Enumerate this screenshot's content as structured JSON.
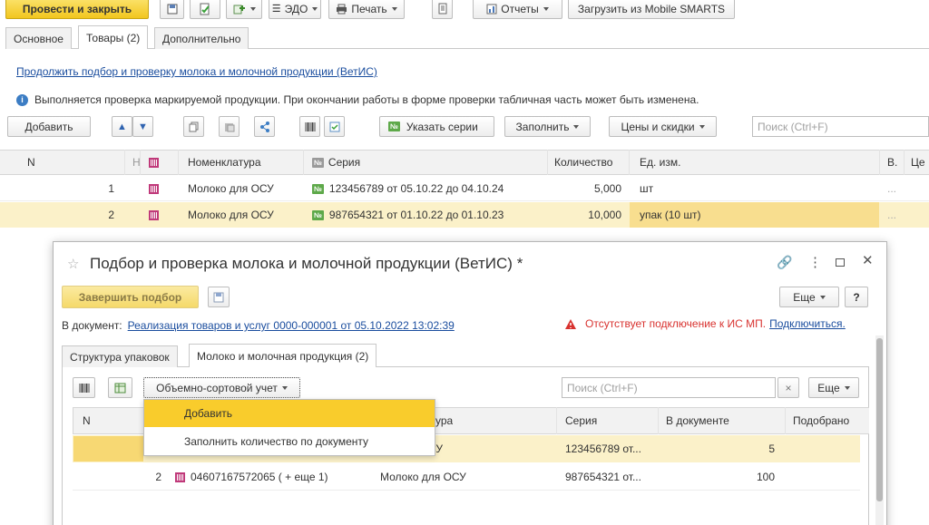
{
  "toolbar": {
    "post_close": "Провести и закрыть",
    "edo": "ЭДО",
    "print": "Печать",
    "reports": "Отчеты",
    "load_mobile": "Загрузить из Mobile SMARTS"
  },
  "tabs": [
    {
      "label": "Основное"
    },
    {
      "label": "Товары (2)"
    },
    {
      "label": "Дополнительно"
    }
  ],
  "continue_link": "Продолжить подбор и проверку молока и молочной продукции (ВетИС)",
  "info_text": "Выполняется проверка маркируемой продукции. При окончании работы в форме проверки табличная часть может быть изменена.",
  "goods_toolbar": {
    "add": "Добавить",
    "series": "Указать серии",
    "fill": "Заполнить",
    "prices": "Цены и скидки",
    "search_placeholder": "Поиск (Ctrl+F)"
  },
  "goods_table": {
    "headers": {
      "n": "N",
      "h": "Н",
      "nom": "Номенклатура",
      "series_no": "№",
      "series": "Серия",
      "qty": "Количество",
      "unit": "Ед. изм.",
      "v": "В.",
      "price": "Це"
    },
    "rows": [
      {
        "n": "1",
        "name": "Молоко для ОСУ",
        "series": "123456789 от 05.10.22 до 04.10.24",
        "qty": "5,000",
        "unit": "шт",
        "v": "..."
      },
      {
        "n": "2",
        "name": "Молоко для ОСУ",
        "series": "987654321 от 01.10.22 до 01.10.23",
        "qty": "10,000",
        "unit": "упак (10 шт)",
        "v": "..."
      }
    ]
  },
  "modal": {
    "title": "Подбор и проверка молока и молочной продукции (ВетИС) *",
    "finish": "Завершить подбор",
    "more": "Еще",
    "help": "?",
    "doc_label": "В документ:",
    "doc_link": "Реализация товаров и услуг 0000-000001 от 05.10.2022 13:02:39",
    "warning": "Отсутствует подключение к ИС МП.",
    "connect": "Подключиться.",
    "tabs": [
      {
        "label": "Структура упаковок"
      },
      {
        "label": "Молоко и молочная продукция (2)"
      }
    ],
    "volume_btn": "Объемно-сортовой учет",
    "search_placeholder": "Поиск (Ctrl+F)",
    "search_clear": "×",
    "more2": "Еще",
    "dropdown": [
      {
        "label": "Добавить"
      },
      {
        "label": "Заполнить количество по документу"
      }
    ],
    "table": {
      "headers": {
        "n": "N",
        "nom": "ура",
        "series": "Серия",
        "in_doc": "В документе",
        "picked": "Подобрано"
      },
      "rows": [
        {
          "n": "",
          "code": "",
          "name": "ля ОСУ",
          "series": "123456789 от...",
          "in_doc": "5"
        },
        {
          "n": "2",
          "code": "04607167572065 ( + еще 1)",
          "name": "Молоко для ОСУ",
          "series": "987654321 от...",
          "in_doc": "100"
        }
      ]
    }
  }
}
